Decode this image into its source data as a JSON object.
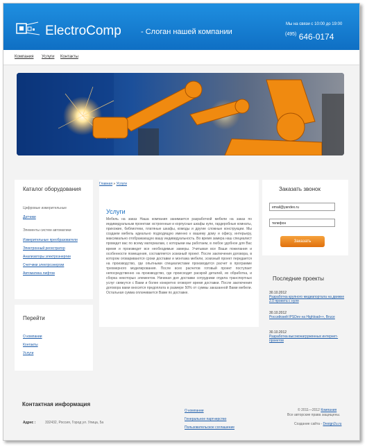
{
  "header": {
    "logo_text": "ElectroComp",
    "slogan": "- Слоган нашей компании",
    "hours": "Мы на связи с 10:00 до 19:00",
    "phone_code": "(495)",
    "phone_number": "646-0174",
    "colors": {
      "bar": "#1784d8",
      "text": "#ffffff"
    }
  },
  "nav": {
    "items": [
      "Компания",
      "Услуги",
      "Контакты"
    ]
  },
  "catalog": {
    "title": "Каталог оборудования",
    "group1_title": "Цифровые измерительные",
    "group1_link": "Датчики",
    "group2_title": "Элементы систем автоматики",
    "links": [
      "Измерительные преобразователи",
      "Электронный регистратор",
      "Анализаторы электроэнергии",
      "Счетчики электроэнергии",
      "Автоматика лифтов"
    ]
  },
  "goto": {
    "title": "Перейти",
    "links": [
      "О компании",
      "Контакты",
      "Услуги"
    ]
  },
  "breadcrumb": {
    "home": "Главная",
    "sep": "»",
    "current": "Услуги"
  },
  "content": {
    "title": "Услуги",
    "text": "Мебель на заказ Наша компания занимается разработкой мебели на заказ по индивидуальным проектам: встроенные и корпусные шкафы купе, гардеробные комнаты, прихожие, библиотеки, платяные шкафы, комоды и другие сложные конструкции. Мы создаем мебель идеально подходящую именно к вашему дому и офису, интерьеру, максимально отображающую вашу индивидуальность. Во время замера наш специалист проведет вас по всему материалам, с которыми мы работаем, в любое удобное для Вас время и произведет все необходимые замеры. Учитывая все Ваши пожелания и особенности помещения, составляется эскизный проект. После заключения договора, в котором оговариваются сроки доставки и монтажа мебели, эскизный проект передается на производство, где опытными специалистами производится расчет в программе трехмерного моделирования. После всех расчетов готовый проект поступает непосредственно на производство, где происходит раскрой деталей, их обработка, и сборка некоторых элементов. Начиная дня доставки сотрудники отдела транспортных услуг свяжутся с Вами и более конкретно оговорят время доставки. После заключения договора вами вносится предоплата в размере 50% от суммы заказанной Вами мебели. Остальная сумма оплачивается Вами по доставке."
  },
  "callback": {
    "title": "Заказать звонок",
    "email_value": "email@yandex.ru",
    "phone_value": "телефон",
    "button_label": "Заказать",
    "button_color": "#ee8a20"
  },
  "projects": {
    "title": "Последние проекты",
    "items": [
      {
        "date": "30.10.2012",
        "text": "Разработка крупного медиапортала на движке 2.0 проекта с нуля"
      },
      {
        "date": "30.10.2012",
        "text": "Российский IPSDev на Highload++, Bruce"
      },
      {
        "date": "30.10.2012",
        "text": "Разработка высоконагруженных интернет-проектов"
      }
    ]
  },
  "footer": {
    "title": "Контактная информация",
    "address_label": "Адрес :",
    "address_value": "332432, Россия, Город ул. Улица, 5а",
    "links": [
      "О компании",
      "Генеральное партнерство",
      "Пользовательское соглашение"
    ],
    "copyright_year": "© 2011—2012",
    "copyright_company": "Компания",
    "rights": "Все авторские права защищены.",
    "made_label": "Создание сайта -",
    "made_link": "Design2u.ru"
  }
}
